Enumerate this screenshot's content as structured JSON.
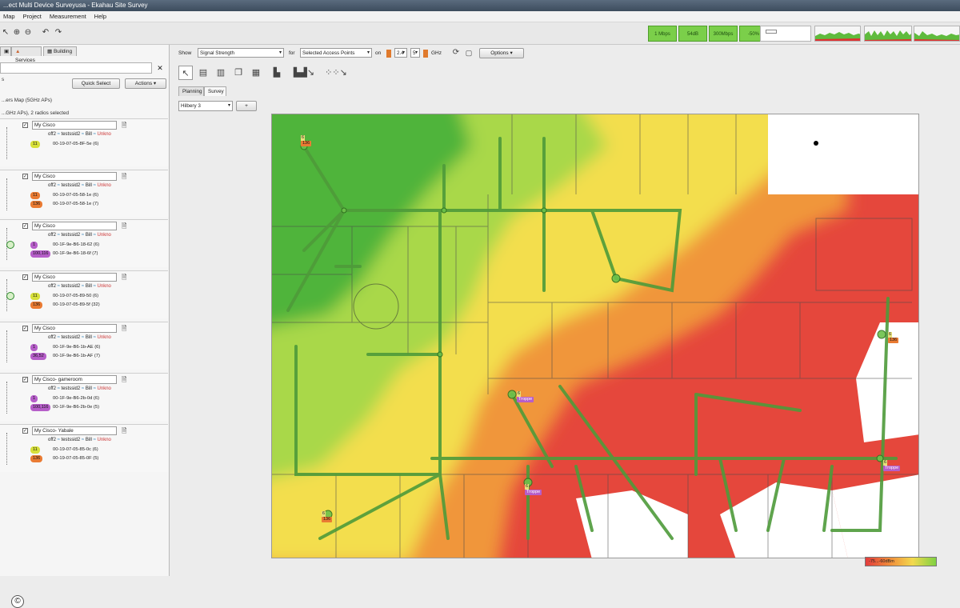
{
  "window": {
    "title": "...ect Multi Device Surveyusa - Ekahau Site Survey"
  },
  "menu": [
    "Map",
    "Project",
    "Measurement",
    "Help"
  ],
  "stats": [
    "1 Mbps",
    "54dB",
    "300Mbps",
    "-50%"
  ],
  "colors": {
    "accent_green": "#7bcf4a",
    "map_green": "#4fb43a",
    "map_yellow": "#f3de4e",
    "map_orange": "#f0963a",
    "map_red": "#e5473c",
    "purple_badge": "#b65ec9",
    "orange_badge": "#ea7b33",
    "yellow_badge": "#d7e03a"
  },
  "left": {
    "tabs": [
      "Services",
      "Building"
    ],
    "search_placeholder": "",
    "quick_select": "Quick Select",
    "actions": "Actions ▾",
    "line1": "...ers Map (5GHz APs)",
    "line2": "...GHz APs), 2 radios selected",
    "cards": [
      {
        "my": "My",
        "name": "Cisco",
        "ssid1": "off2",
        "ssid2": "testssid2",
        "ssid3": "Bill",
        "status": "Unkno",
        "badges": [
          {
            "text": "11",
            "color": "#d7e03a",
            "mac": "00-19-07-05-8F-5e (6)"
          }
        ]
      },
      {
        "my": "My",
        "name": "Cisco",
        "ssid1": "off2",
        "ssid2": "testssid2",
        "ssid3": "Bill",
        "status": "Unkno",
        "badges": [
          {
            "text": "11",
            "color": "#ea7b33",
            "mac": "00-19-07-05-58-1e (6)"
          },
          {
            "text": "136",
            "color": "#ea7b33",
            "mac": "00-19-07-05-58-1e (7)"
          }
        ]
      },
      {
        "my": "My",
        "name": "Cisco",
        "ssid1": "off2",
        "ssid2": "testssid2",
        "ssid3": "Bill",
        "status": "Unkno",
        "badges": [
          {
            "text": "1",
            "color": "#b65ec9",
            "mac": "00-1F-9e-B6-18-62 (6)"
          },
          {
            "text": "100,116",
            "color": "#b65ec9",
            "mac": "00-1F-9e-B6-18-6f (7)"
          }
        ]
      },
      {
        "my": "My",
        "name": "Cisco",
        "ssid1": "off2",
        "ssid2": "testssid2",
        "ssid3": "Bill",
        "status": "Unkno",
        "badges": [
          {
            "text": "11",
            "color": "#d7e03a",
            "mac": "00-19-07-05-89-50 (6)"
          },
          {
            "text": "136",
            "color": "#ea7b33",
            "mac": "00-19-07-05-89-5f (32)"
          }
        ]
      },
      {
        "my": "My",
        "name": "Cisco",
        "ssid1": "off2",
        "ssid2": "testssid2",
        "ssid3": "Bill",
        "status": "Unkno",
        "badges": [
          {
            "text": "1",
            "color": "#b65ec9",
            "mac": "00-1F-9e-B6-1b-AE (6)"
          },
          {
            "text": "36,52",
            "color": "#b65ec9",
            "mac": "00-1F-9e-B6-1b-AF (7)"
          }
        ]
      },
      {
        "my": "My",
        "name": "Cisco- gameroom",
        "ssid1": "off2",
        "ssid2": "testssid2",
        "ssid3": "Bill",
        "status": "Unkno",
        "badges": [
          {
            "text": "1",
            "color": "#b65ec9",
            "mac": "00-1F-9e-B6-2b-0d (6)"
          },
          {
            "text": "100,116",
            "color": "#b65ec9",
            "mac": "00-1F-9e-B6-2b-0e (5)"
          }
        ]
      },
      {
        "my": "My",
        "name": "Cisco- Yabale",
        "ssid1": "off2",
        "ssid2": "testssid2",
        "ssid3": "Bill",
        "status": "Unkno",
        "badges": [
          {
            "text": "11",
            "color": "#d7e03a",
            "mac": "00-19-07-05-85-0c (6)"
          },
          {
            "text": "136",
            "color": "#ea7b33",
            "mac": "00-19-07-05-85-0F (5)"
          }
        ]
      }
    ]
  },
  "right": {
    "show_label": "Show",
    "show_value": "Signal Strength",
    "for_label": "for",
    "for_value": "Selected Access Points",
    "on_label": "on",
    "field1": "2.4",
    "field2": "5",
    "ghz": "GHz",
    "options": "Options ▾",
    "tabs": [
      "Planning",
      "Survey"
    ],
    "floor": "Hilbery 3",
    "floor_btn": "+",
    "legend": "-75...-60dBm"
  },
  "map": {
    "ap_labels": [
      {
        "name": "6",
        "ch": "136",
        "style": "orange"
      },
      {
        "name": "6",
        "ch": "Troppe",
        "style": "purple"
      },
      {
        "name": "6",
        "ch": "Troppe",
        "style": "purple"
      },
      {
        "name": "6",
        "ch": "Troppe",
        "style": "purple"
      },
      {
        "name": "6",
        "ch": "136",
        "style": "orange"
      },
      {
        "name": "6",
        "ch": "136",
        "style": "orange"
      }
    ]
  }
}
